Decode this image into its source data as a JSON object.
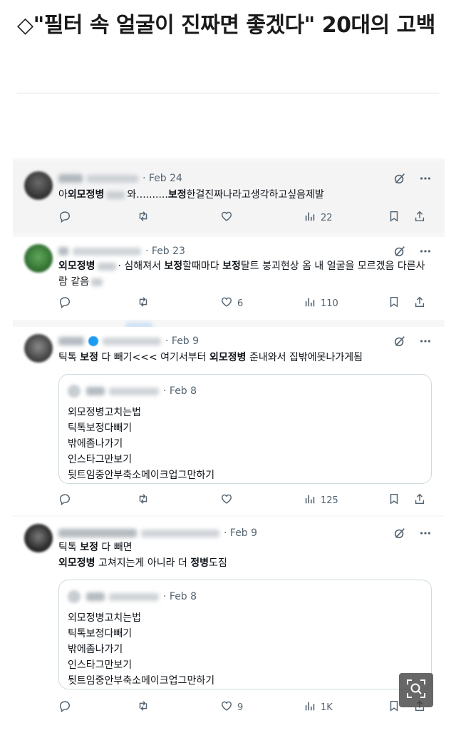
{
  "article": {
    "headline": "◇\"필터 속 얼굴이 진짜면 좋겠다\" 20대의 고백"
  },
  "tweets": [
    {
      "date": "· Feb 24",
      "text_parts": [
        "아",
        "외모정병",
        "",
        "와..........",
        "보정",
        "한걸진짜나라고생각하고싶음제발"
      ],
      "stats": {
        "replies": "",
        "reposts": "",
        "likes": "",
        "views": "22"
      }
    },
    {
      "date": "· Feb 23",
      "text_parts": [
        "외모정병",
        "· 심해져서 ",
        "보정",
        "할때마다 ",
        "보정",
        "탈트 붕괴현상 옴 내 얼굴을 모르겠음 다른사람 같음"
      ],
      "stats": {
        "replies": "",
        "reposts": "",
        "likes": "6",
        "views": "110"
      }
    },
    {
      "date": "· Feb 9",
      "text_parts": [
        "틱톡 ",
        "보정",
        " 다 빼기<<< 여기서부터 ",
        "외모정병",
        " 준내와서 집밖에못나가게됨"
      ],
      "quote": {
        "date": "· Feb 8",
        "lines": [
          "외모정병고치는법",
          "틱톡보정다빼기",
          "밖에좀나가기",
          "인스타그만보기",
          "뒷트임중안부축소메이크업그만하기"
        ]
      },
      "stats": {
        "replies": "",
        "reposts": "",
        "likes": "",
        "views": "125"
      }
    },
    {
      "date": "· Feb 9",
      "line1_parts": [
        "틱톡 ",
        "보정",
        " 다 빼면"
      ],
      "line2_parts": [
        "외모정병",
        " 고쳐지는게 아니라 더 ",
        "정병",
        "도짐"
      ],
      "quote": {
        "date": "· Feb 8",
        "lines": [
          "외모정병고치는법",
          "틱톡보정다빼기",
          "밖에좀나가기",
          "인스타그만보기",
          "뒷트임중안부축소메이크업그만하기"
        ]
      },
      "stats": {
        "replies": "",
        "reposts": "",
        "likes": "9",
        "views": "1K"
      }
    }
  ],
  "icons": {
    "reply": "reply-icon",
    "repost": "repost-icon",
    "like": "heart-icon",
    "views": "views-icon",
    "bookmark": "bookmark-icon",
    "share": "share-icon",
    "grok": "grok-icon",
    "more": "more-icon",
    "zoom": "zoom-icon"
  },
  "colors": {
    "text": "#0f1419",
    "muted": "#536471",
    "border": "#cfd9de",
    "verified": "#1d9bf0"
  }
}
